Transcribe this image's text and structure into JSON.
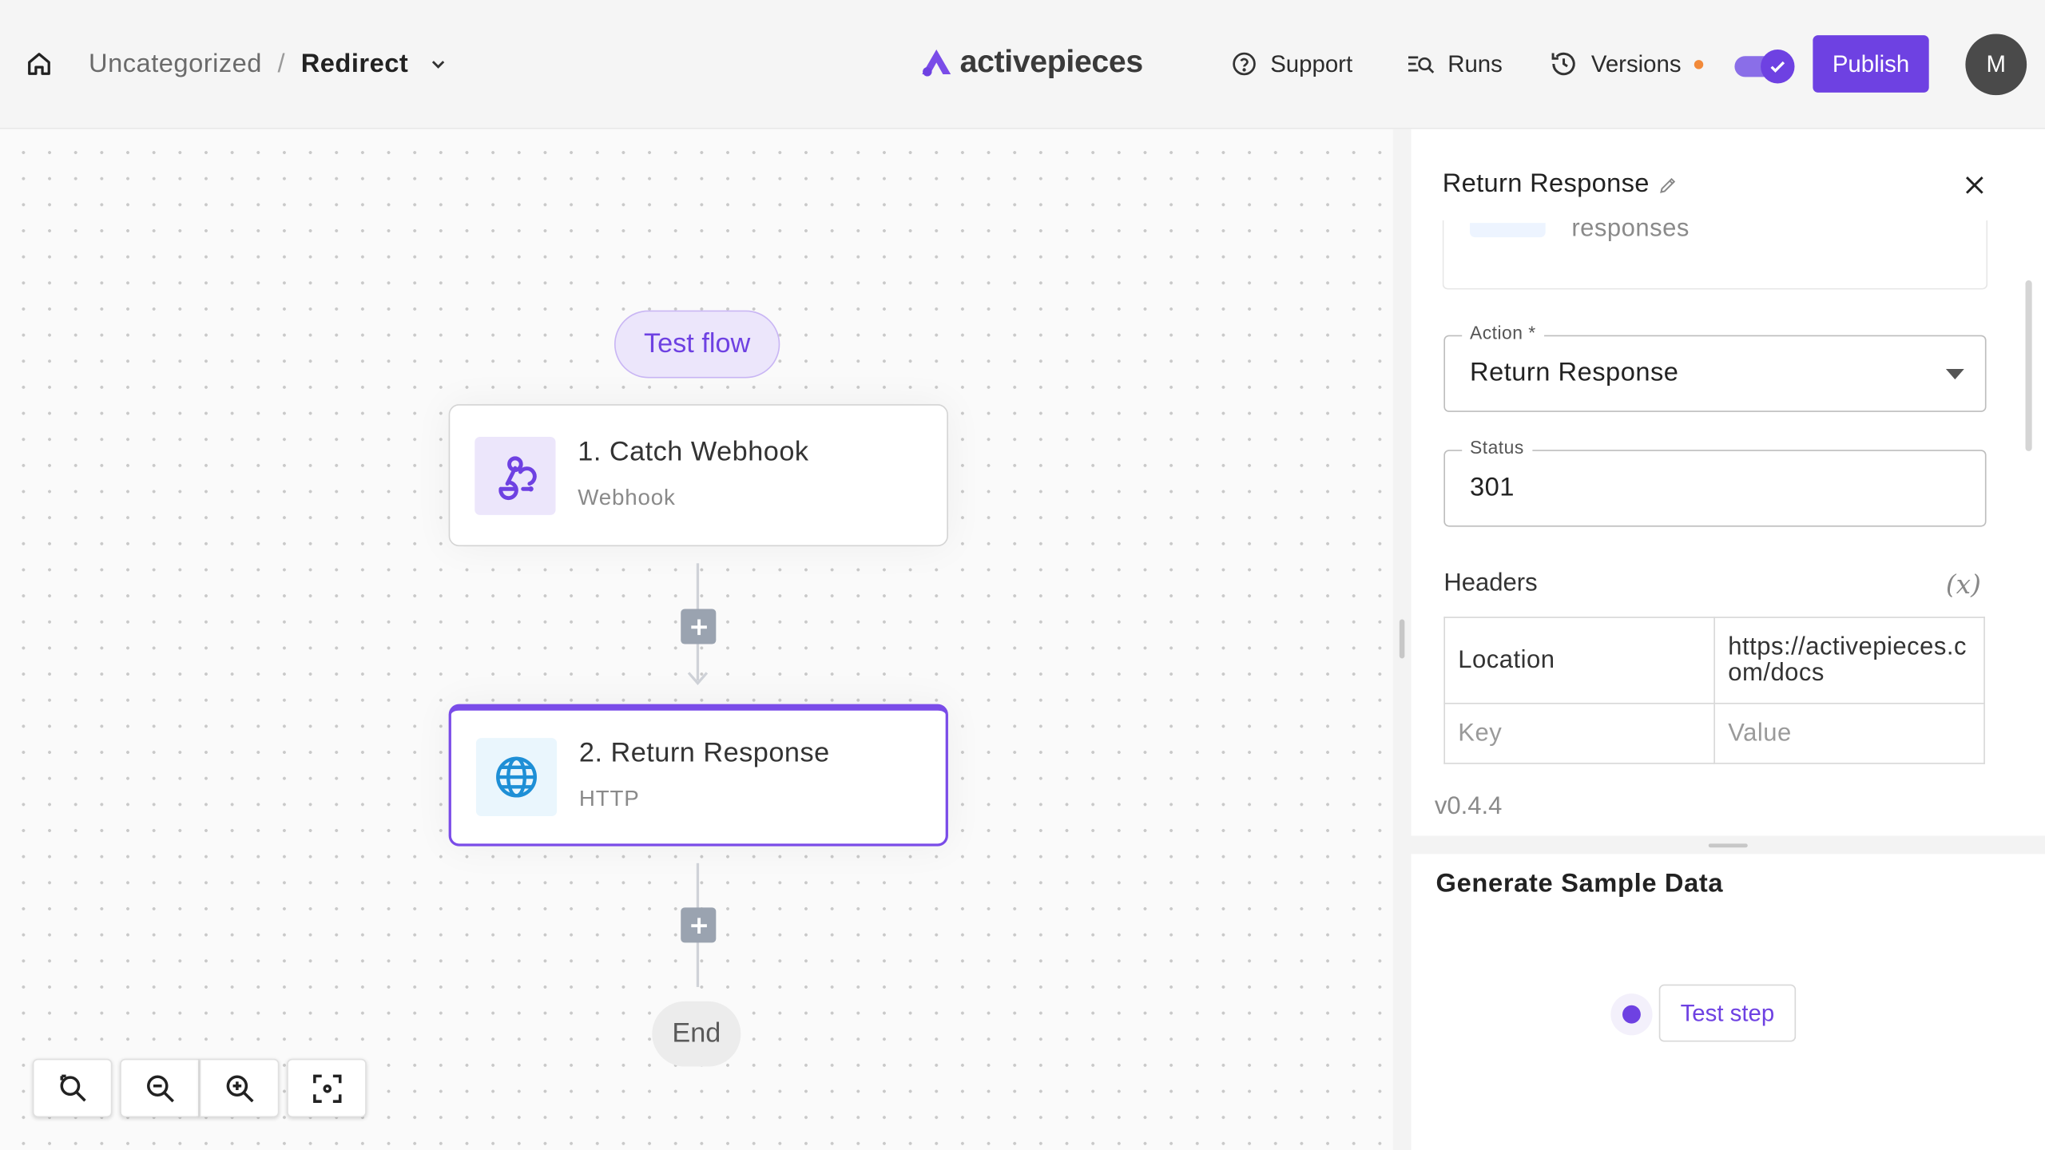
{
  "header": {
    "breadcrumb_folder": "Uncategorized",
    "breadcrumb_separator": "/",
    "flow_name": "Redirect",
    "logo_text": "activepieces",
    "support_label": "Support",
    "runs_label": "Runs",
    "versions_label": "Versions",
    "publish_label": "Publish",
    "avatar_initial": "M",
    "toggle_enabled": true
  },
  "canvas": {
    "test_flow_label": "Test flow",
    "steps": [
      {
        "title": "1. Catch Webhook",
        "subtitle": "Webhook",
        "icon": "webhook-icon"
      },
      {
        "title": "2. Return Response",
        "subtitle": "HTTP",
        "icon": "globe-icon"
      }
    ],
    "end_label": "End",
    "zoom_controls": [
      "reset-zoom-icon",
      "zoom-out-icon",
      "zoom-in-icon",
      "fit-view-icon"
    ]
  },
  "panel": {
    "title": "Return Response",
    "piece_description": "responses",
    "action_label": "Action *",
    "action_value": "Return Response",
    "status_label": "Status",
    "status_value": "301",
    "headers_label": "Headers",
    "headers_fx": "(x)",
    "headers_rows": [
      {
        "key": "Location",
        "value": "https://activepieces.com/docs"
      }
    ],
    "key_placeholder": "Key",
    "value_placeholder": "Value",
    "version": "v0.4.4"
  },
  "sample_data": {
    "title": "Generate Sample Data",
    "test_step_label": "Test step"
  },
  "colors": {
    "primary": "#6e41e2",
    "publish_bg": "#6e41e2",
    "versions_dot": "#f28a3a",
    "selected_border": "#7a4ce8"
  }
}
